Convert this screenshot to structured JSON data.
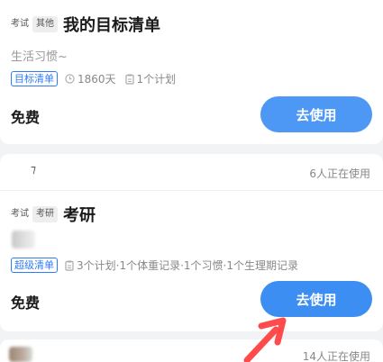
{
  "card1": {
    "tags": [
      "考试",
      "其他"
    ],
    "title": "我的目标清单",
    "subtitle": "生活习惯~",
    "badge": "目标清单",
    "meta": [
      "1860天",
      "1个计划"
    ],
    "price": "免费",
    "button": "去使用"
  },
  "strip1": {
    "mark": "⁊",
    "user_count": "6人正在使用"
  },
  "card2": {
    "tags": [
      "考试",
      "考研"
    ],
    "title": "考研",
    "badge": "超级清单",
    "meta": "3个计划·1个体重记录·1个习惯·1个生理期记录",
    "price": "免费",
    "button": "去使用"
  },
  "strip2": {
    "user_count": "14人正在使用"
  },
  "colors": {
    "accent": "#4d97f5",
    "badge_blue": "#2f7bf5",
    "arrow": "#ff4b4b"
  },
  "icons": [
    "clock-icon",
    "clipboard-icon",
    "arrow-annotation"
  ]
}
